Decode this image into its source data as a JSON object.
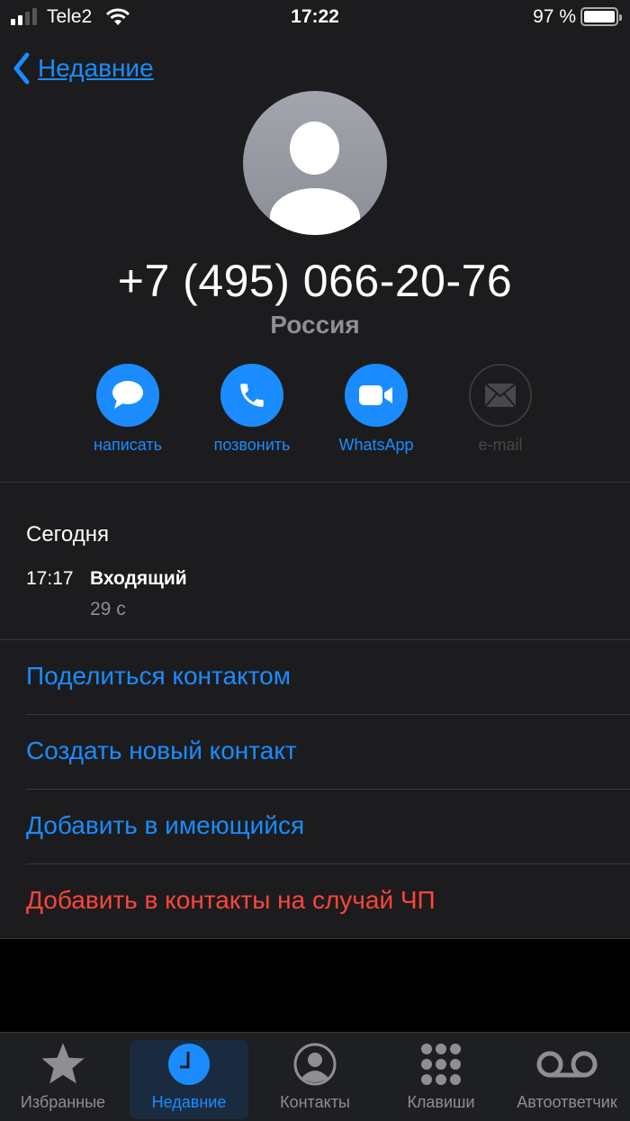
{
  "status_bar": {
    "carrier": "Tele2",
    "time": "17:22",
    "battery_percent": "97 %",
    "signal_bars_active": 2,
    "signal_bars_total": 4
  },
  "nav": {
    "back_label": "Недавние"
  },
  "contact": {
    "phone": "+7 (495) 066-20-76",
    "country": "Россия"
  },
  "actions": [
    {
      "label": "написать",
      "icon": "message-icon",
      "enabled": true
    },
    {
      "label": "позвонить",
      "icon": "phone-icon",
      "enabled": true
    },
    {
      "label": "WhatsApp",
      "icon": "video-icon",
      "enabled": true
    },
    {
      "label": "e-mail",
      "icon": "mail-icon",
      "enabled": false
    }
  ],
  "history": {
    "day": "Сегодня",
    "entries": [
      {
        "time": "17:17",
        "type": "Входящий",
        "duration": "29 с"
      }
    ]
  },
  "menu": [
    {
      "label": "Поделиться контактом",
      "destructive": false
    },
    {
      "label": "Создать новый контакт",
      "destructive": false
    },
    {
      "label": "Добавить в имеющийся",
      "destructive": false
    },
    {
      "label": "Добавить в контакты на случай ЧП",
      "destructive": true
    }
  ],
  "tabbar": {
    "active": 1,
    "items": [
      {
        "label": "Избранные",
        "icon": "star-icon"
      },
      {
        "label": "Недавние",
        "icon": "clock-icon"
      },
      {
        "label": "Контакты",
        "icon": "contact-icon"
      },
      {
        "label": "Клавиши",
        "icon": "keypad-icon"
      },
      {
        "label": "Автоответчик",
        "icon": "voicemail-icon"
      }
    ]
  },
  "colors": {
    "accent": "#1a8cff",
    "destructive": "#ff453a",
    "background": "#1c1c1e",
    "secondary_text": "#8e8e93"
  }
}
